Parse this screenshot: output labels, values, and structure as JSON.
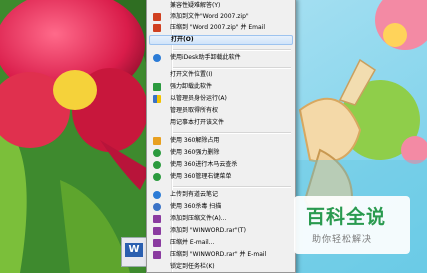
{
  "menu": {
    "items": [
      {
        "label": "兼容性疑难解答(Y)",
        "icon": "compat-icon",
        "color": ""
      },
      {
        "label": "添加到文件\"Word 2007.zip\"",
        "icon": "zip-icon",
        "color": "#d04020"
      },
      {
        "label": "压缩到 \"Word 2007.zip\" 并 Email",
        "icon": "zip-email-icon",
        "color": "#d04020"
      },
      {
        "label": "打开(O)",
        "icon": "",
        "color": "",
        "bold": true,
        "highlight": true
      },
      {
        "label": "使用iDesk助手卸载此软件",
        "icon": "idesk-icon",
        "color": "#2b7bd6"
      },
      {
        "label": "打开文件位置(I)",
        "icon": "",
        "color": ""
      },
      {
        "label": "强力卸载此软件",
        "icon": "uninstall-icon",
        "color": "#2b9a3e"
      },
      {
        "label": "以管理员身份运行(A)",
        "icon": "shield-icon",
        "color": "#3a72c6"
      },
      {
        "label": "管理员取得所有权",
        "icon": "",
        "color": ""
      },
      {
        "label": "用记事本打开该文件",
        "icon": "",
        "color": ""
      },
      {
        "label": "使用 360解除占用",
        "icon": "unlock-icon",
        "color": "#e8a020"
      },
      {
        "label": "使用 360强力删除",
        "icon": "delete-icon",
        "color": "#2b9a3e"
      },
      {
        "label": "使用 360进行木马云查杀",
        "icon": "trojan-scan-icon",
        "color": "#2b9a3e"
      },
      {
        "label": "使用 360管理右键菜单",
        "icon": "menu-manage-icon",
        "color": "#2b9a3e"
      },
      {
        "label": "上传到有道云笔记",
        "icon": "youdao-icon",
        "color": "#2b7bd6"
      },
      {
        "label": "使用 360杀毒 扫描",
        "icon": "antivirus-icon",
        "color": "#3a72c6"
      },
      {
        "label": "添加到压缩文件(A)...",
        "icon": "rar-icon",
        "color": "#8a3ba0"
      },
      {
        "label": "添加到 \"WINWORD.rar\"(T)",
        "icon": "rar-icon",
        "color": "#8a3ba0"
      },
      {
        "label": "压缩并 E-mail...",
        "icon": "rar-email-icon",
        "color": "#8a3ba0"
      },
      {
        "label": "压缩到 \"WINWORD.rar\" 并 E-mail",
        "icon": "rar-email-icon",
        "color": "#8a3ba0"
      },
      {
        "label": "锁定到任务栏(K)",
        "icon": "",
        "color": ""
      }
    ]
  },
  "watermark": {
    "title": "百科全说",
    "subtitle": "助你轻松解决"
  },
  "file_icon": {
    "glyph": "W"
  }
}
